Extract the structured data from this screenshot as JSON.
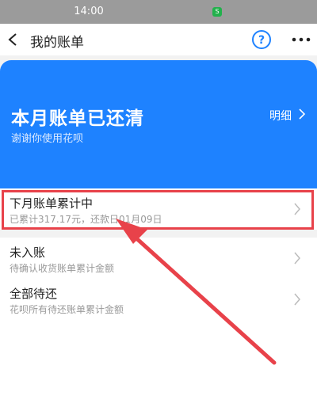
{
  "status": {
    "time": "14:00",
    "badge": "S"
  },
  "nav": {
    "title": "我的账单",
    "help": "?"
  },
  "hero": {
    "title": "本月账单已还清",
    "subtitle": "谢谢你使用花呗",
    "detail_link": "明细"
  },
  "rows": [
    {
      "title": "下月账单累计中",
      "desc": "已累计317.17元，还款日01月09日"
    },
    {
      "title": "未入账",
      "desc": "待确认收货账单累计金额"
    },
    {
      "title": "全部待还",
      "desc": "花呗所有待还账单累计金额"
    }
  ],
  "colors": {
    "primary": "#1e82ff",
    "annotation": "#e8424a",
    "status_bar": "#9b9b9b"
  }
}
